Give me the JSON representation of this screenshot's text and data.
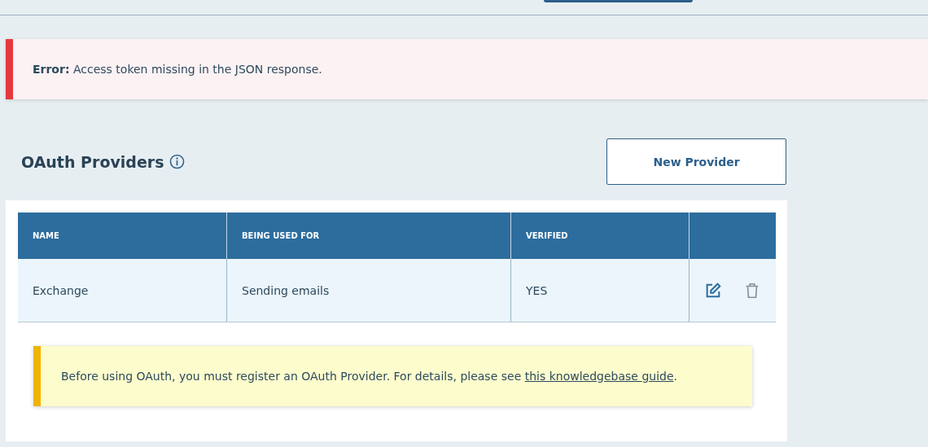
{
  "error_banner": {
    "label": "Error:",
    "message": "Access token missing in the JSON response."
  },
  "section": {
    "title": "OAuth Providers",
    "new_button": "New Provider"
  },
  "table": {
    "columns": [
      "NAME",
      "BEING USED FOR",
      "VERIFIED"
    ],
    "rows": [
      {
        "cells": [
          "Exchange",
          "Sending emails",
          "YES"
        ]
      }
    ]
  },
  "note": {
    "text": "Before using OAuth, you must register an OAuth Provider. For details, please see ",
    "link": "this knowledgebase guide",
    "after": "."
  }
}
